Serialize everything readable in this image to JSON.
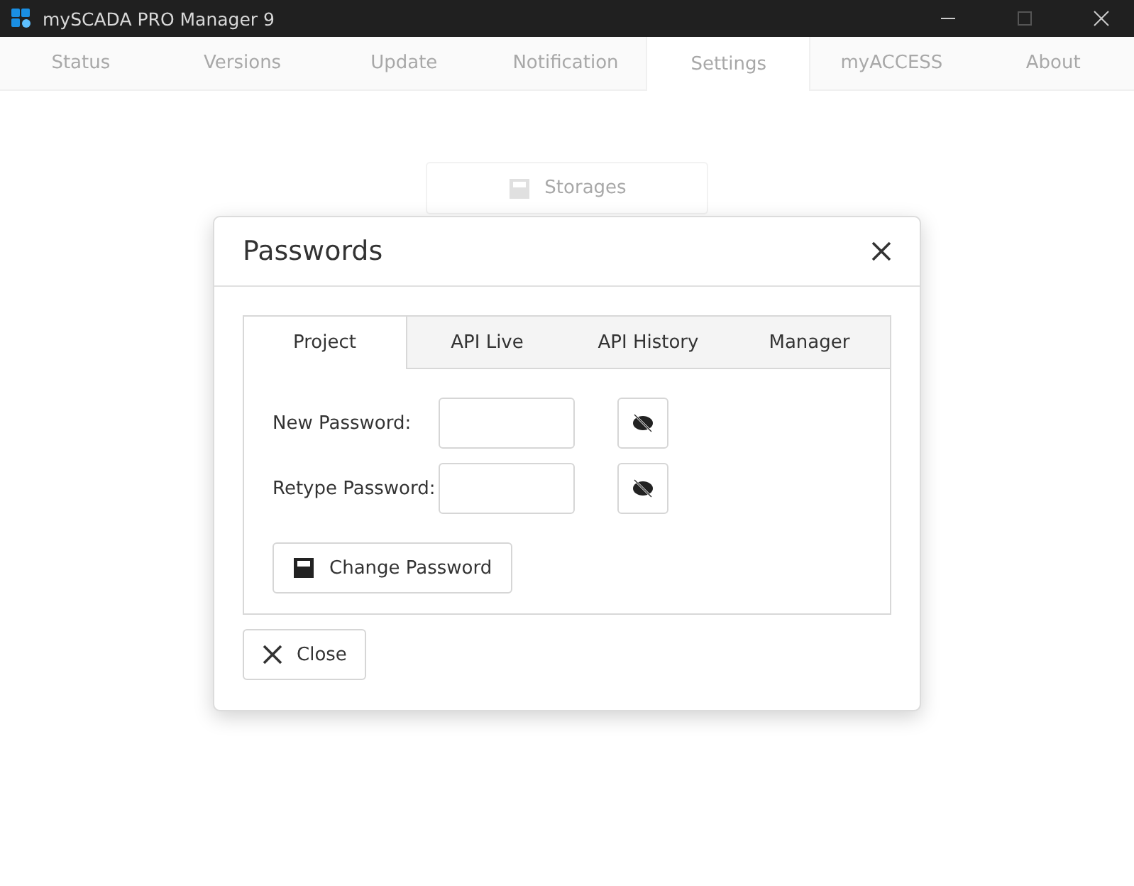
{
  "window": {
    "title": "mySCADA PRO Manager 9"
  },
  "tabs": [
    {
      "label": "Status",
      "selected": false
    },
    {
      "label": "Versions",
      "selected": false
    },
    {
      "label": "Update",
      "selected": false
    },
    {
      "label": "Notification",
      "selected": false
    },
    {
      "label": "Settings",
      "selected": true
    },
    {
      "label": "myACCESS",
      "selected": false
    },
    {
      "label": "About",
      "selected": false
    }
  ],
  "storages_button": "Storages",
  "dialog": {
    "title": "Passwords",
    "tabs": [
      {
        "label": "Project",
        "selected": true
      },
      {
        "label": "API Live",
        "selected": false
      },
      {
        "label": "API History",
        "selected": false
      },
      {
        "label": "Manager",
        "selected": false
      }
    ],
    "fields": [
      {
        "label": "New Password:"
      },
      {
        "label": "Retype Password:"
      }
    ],
    "change_button": "Change Password",
    "close_button": "Close"
  }
}
